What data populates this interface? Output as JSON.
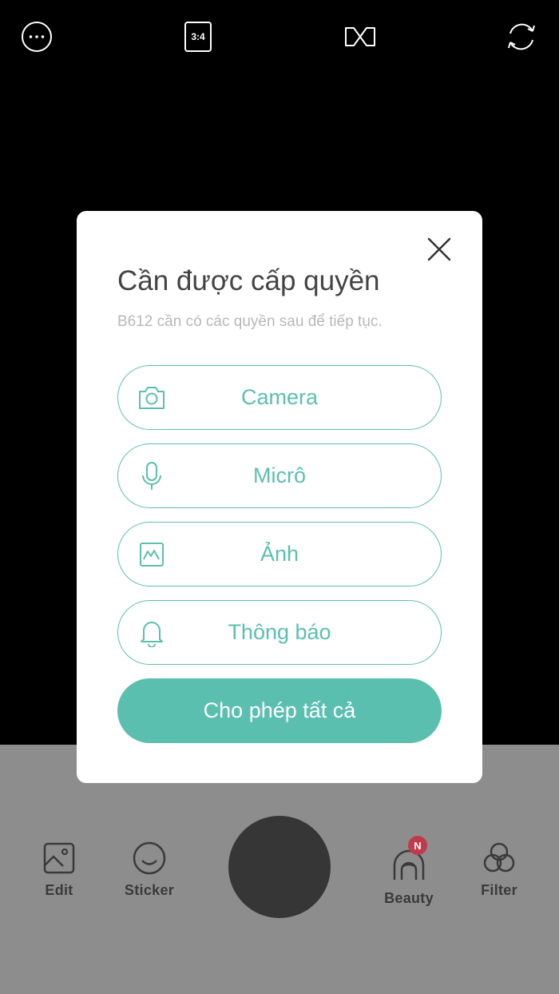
{
  "topbar": {
    "more_icon": "ellipsis-circle-icon",
    "ratio_label": "3:4",
    "effects_icon": "infinity-icon",
    "flip_icon": "camera-flip-icon"
  },
  "dialog": {
    "title": "Cần được cấp quyền",
    "subtitle": "B612 cần có các quyền sau để tiếp tục.",
    "close_icon": "close-icon",
    "permissions": [
      {
        "label": "Camera",
        "icon": "camera-icon"
      },
      {
        "label": "Micrô",
        "icon": "microphone-icon"
      },
      {
        "label": "Ảnh",
        "icon": "photo-icon"
      },
      {
        "label": "Thông báo",
        "icon": "bell-icon"
      }
    ],
    "allow_all_label": "Cho phép tất cả"
  },
  "bottombar": {
    "edit_label": "Edit",
    "sticker_label": "Sticker",
    "beauty_label": "Beauty",
    "beauty_badge": "N",
    "filter_label": "Filter"
  },
  "colors": {
    "accent": "#5bbfb0",
    "overlay_gray": "#8d8d8d",
    "badge_red": "#c0394d",
    "shutter": "#363636"
  }
}
